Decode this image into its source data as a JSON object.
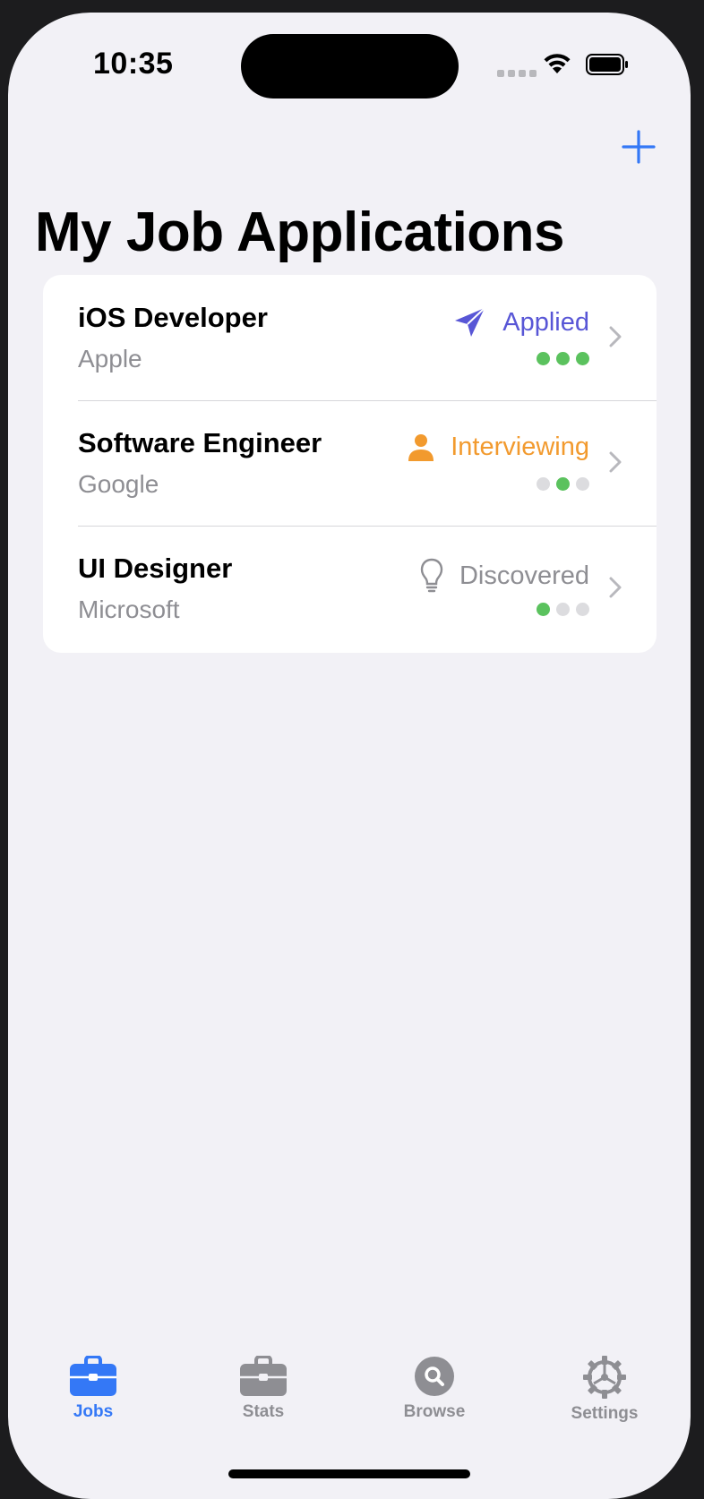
{
  "status_bar": {
    "time": "10:35"
  },
  "header": {
    "title": "My Job Applications",
    "add_icon": "plus-icon"
  },
  "jobs": [
    {
      "title": "iOS Developer",
      "company": "Apple",
      "status": "Applied",
      "status_icon": "paperplane-icon",
      "status_color": "#5856d6",
      "progress_filled": [
        true,
        true,
        true
      ]
    },
    {
      "title": "Software Engineer",
      "company": "Google",
      "status": "Interviewing",
      "status_icon": "person-icon",
      "status_color": "#f29a2e",
      "progress_filled": [
        false,
        true,
        false
      ]
    },
    {
      "title": "UI Designer",
      "company": "Microsoft",
      "status": "Discovered",
      "status_icon": "lightbulb-icon",
      "status_color": "#8e8e93",
      "progress_filled": [
        true,
        false,
        false
      ]
    }
  ],
  "tabs": [
    {
      "label": "Jobs",
      "icon": "briefcase-icon",
      "active": true
    },
    {
      "label": "Stats",
      "icon": "briefcase-icon",
      "active": false
    },
    {
      "label": "Browse",
      "icon": "search-icon",
      "active": false
    },
    {
      "label": "Settings",
      "icon": "gear-icon",
      "active": false
    }
  ],
  "colors": {
    "accent": "#3478f6",
    "progress_on": "#5bc25e",
    "progress_off": "#dcdcdf",
    "secondary_text": "#8e8e93"
  }
}
